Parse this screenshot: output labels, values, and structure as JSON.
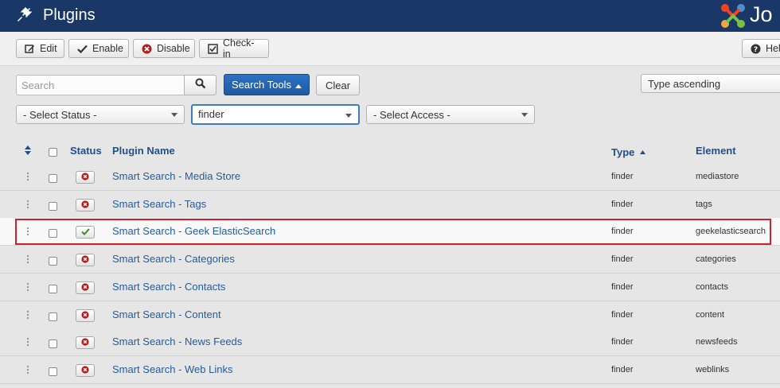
{
  "header": {
    "title": "Plugins",
    "logo_text": "Jo"
  },
  "toolbar": {
    "edit": "Edit",
    "enable": "Enable",
    "disable": "Disable",
    "checkin": "Check-in",
    "help": "Hel"
  },
  "filters": {
    "search_placeholder": "Search",
    "search_tools": "Search Tools",
    "clear": "Clear",
    "ordering": "Type ascending",
    "status": "- Select Status -",
    "folder": "finder",
    "access": "- Select Access -"
  },
  "columns": {
    "status": "Status",
    "name": "Plugin Name",
    "type": "Type",
    "element": "Element"
  },
  "rows": [
    {
      "name": "Smart Search - Media Store",
      "type": "finder",
      "element": "mediastore",
      "enabled": false
    },
    {
      "name": "Smart Search - Tags",
      "type": "finder",
      "element": "tags",
      "enabled": false
    },
    {
      "name": "Smart Search - Geek ElasticSearch",
      "type": "finder",
      "element": "geekelasticsearch",
      "enabled": true
    },
    {
      "name": "Smart Search - Categories",
      "type": "finder",
      "element": "categories",
      "enabled": false
    },
    {
      "name": "Smart Search - Contacts",
      "type": "finder",
      "element": "contacts",
      "enabled": false
    },
    {
      "name": "Smart Search - Content",
      "type": "finder",
      "element": "content",
      "enabled": false
    },
    {
      "name": "Smart Search - News Feeds",
      "type": "finder",
      "element": "newsfeeds",
      "enabled": false
    },
    {
      "name": "Smart Search - Web Links",
      "type": "finder",
      "element": "weblinks",
      "enabled": false
    }
  ],
  "colors": {
    "header_bg": "#1a3867",
    "link": "#245c9c",
    "primary_button": "#2a73c4",
    "disabled_icon": "#b51c1c",
    "enabled_icon": "#3c8a2e",
    "highlight_border": "#d0202e"
  }
}
